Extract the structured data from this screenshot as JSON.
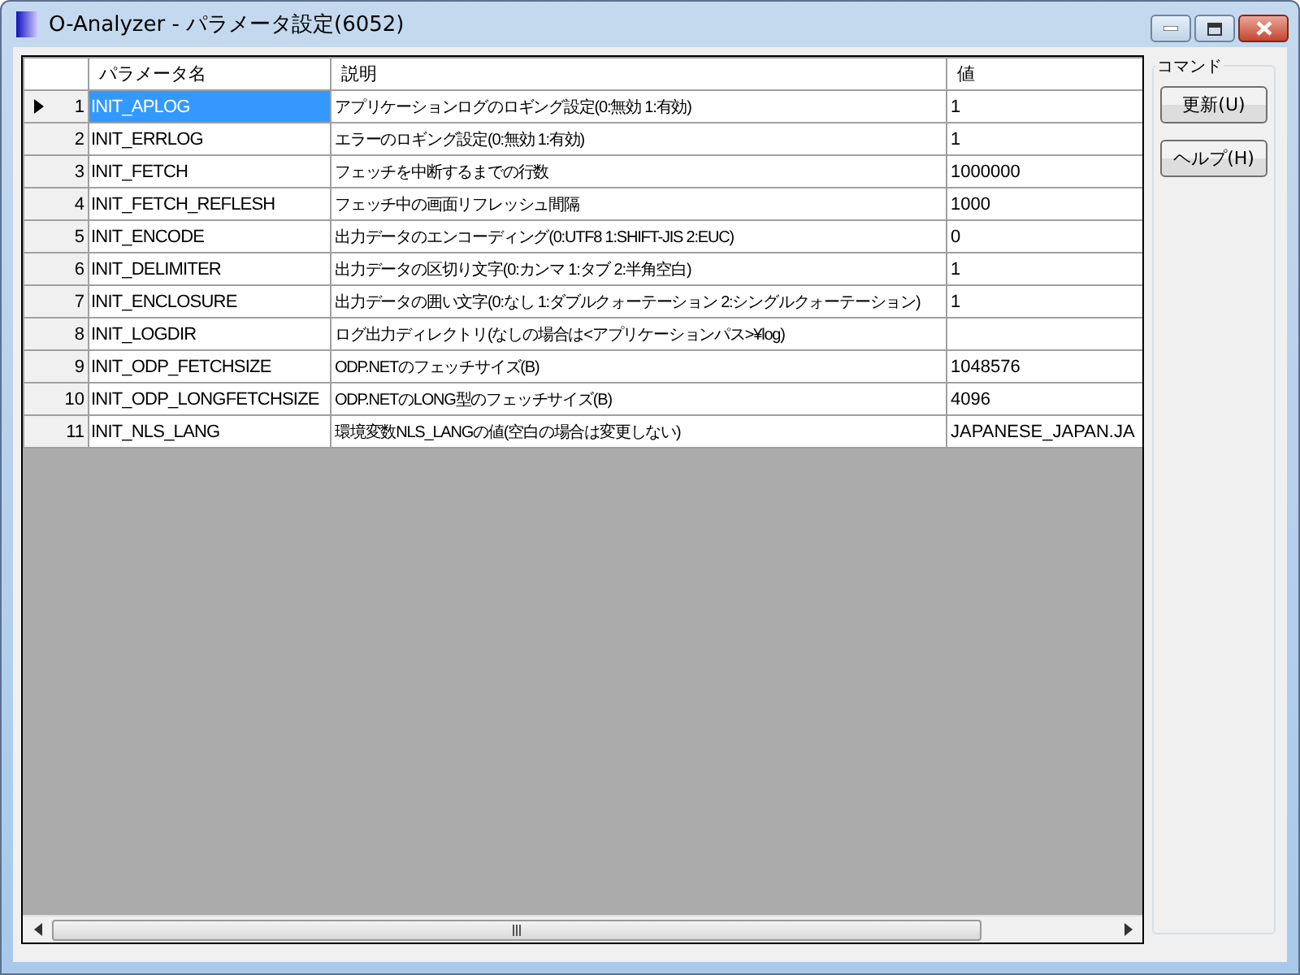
{
  "window": {
    "title": "O-Analyzer - パラメータ設定(6052)"
  },
  "table": {
    "columns": [
      "パラメータ名",
      "説明",
      "値"
    ],
    "rows": [
      {
        "number": "1",
        "name": "INIT_APLOG",
        "description": "アプリケーションログのロギング設定(0:無効 1:有効)",
        "value": "1",
        "selected": true
      },
      {
        "number": "2",
        "name": "INIT_ERRLOG",
        "description": "エラーのロギング設定(0:無効 1:有効)",
        "value": "1",
        "selected": false
      },
      {
        "number": "3",
        "name": "INIT_FETCH",
        "description": "フェッチを中断するまでの行数",
        "value": "1000000",
        "selected": false
      },
      {
        "number": "4",
        "name": "INIT_FETCH_REFLESH",
        "description": "フェッチ中の画面リフレッシュ間隔",
        "value": "1000",
        "selected": false
      },
      {
        "number": "5",
        "name": "INIT_ENCODE",
        "description": "出力データのエンコーディング(0:UTF8 1:SHIFT-JIS 2:EUC)",
        "value": "0",
        "selected": false
      },
      {
        "number": "6",
        "name": "INIT_DELIMITER",
        "description": "出力データの区切り文字(0:カンマ 1:タブ 2:半角空白)",
        "value": "1",
        "selected": false
      },
      {
        "number": "7",
        "name": "INIT_ENCLOSURE",
        "description": "出力データの囲い文字(0:なし 1:ダブルクォーテーション 2:シングルクォーテーション)",
        "value": "1",
        "selected": false
      },
      {
        "number": "8",
        "name": "INIT_LOGDIR",
        "description": "ログ出力ディレクトリ(なしの場合は<アプリケーションパス>¥log)",
        "selected": false
      },
      {
        "number": "9",
        "name": "INIT_ODP_FETCHSIZE",
        "description": "ODP.NETのフェッチサイズ(B)",
        "value": "1048576",
        "selected": false
      },
      {
        "number": "10",
        "name": "INIT_ODP_LONGFETCHSIZE",
        "description": "ODP.NETのLONG型のフェッチサイズ(B)",
        "value": "4096",
        "selected": false
      },
      {
        "number": "11",
        "name": "INIT_NLS_LANG",
        "description": "環境変数NLS_LANGの値(空白の場合は変更しない)",
        "value": "JAPANESE_JAPAN.JA",
        "selected": false
      }
    ]
  },
  "command_panel": {
    "title": "コマンド",
    "buttons": [
      "更新(U)",
      "ヘルプ(H)"
    ]
  }
}
